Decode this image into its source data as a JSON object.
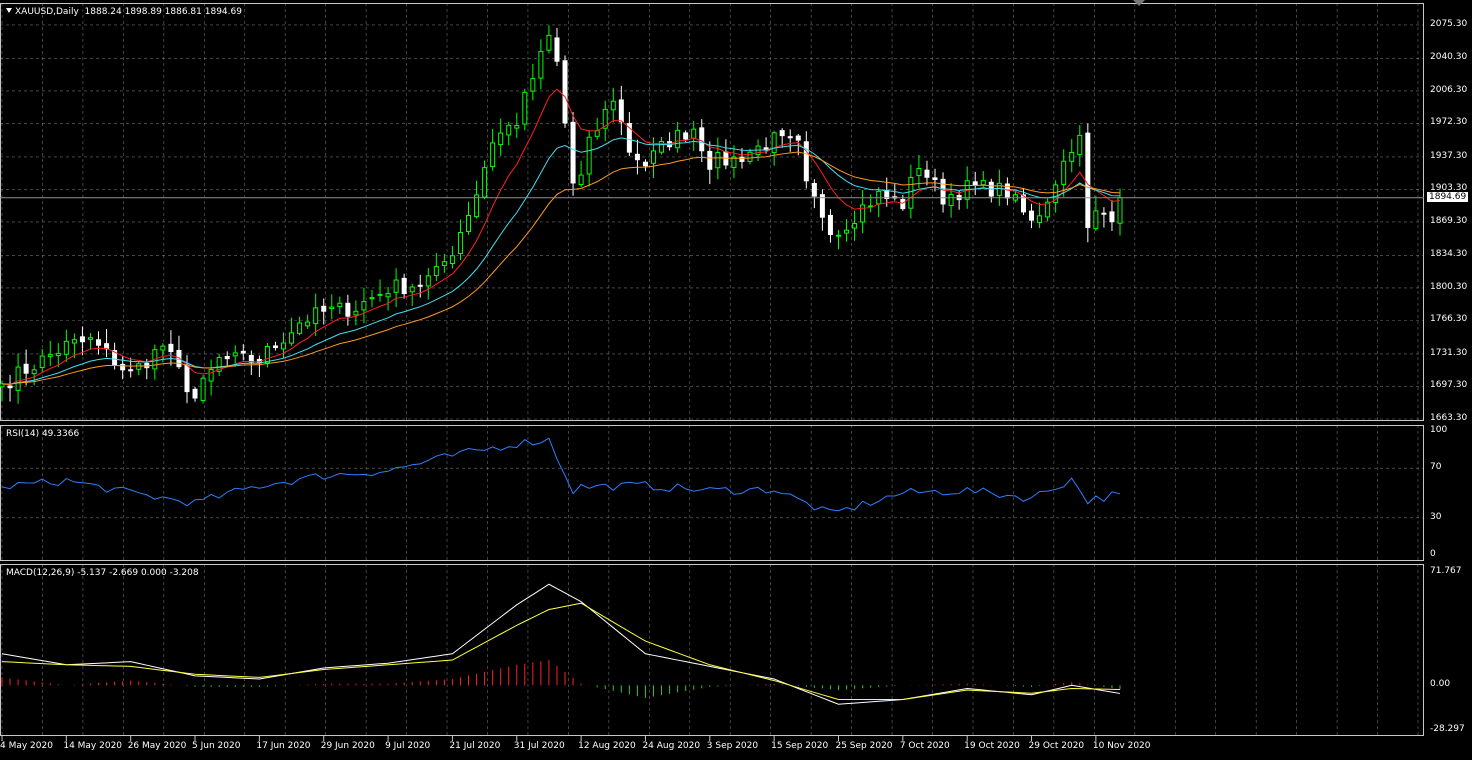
{
  "chart_header": {
    "symbol": "XAUUSD,Daily",
    "ohlc": "1888.24 1898.89 1886.81 1894.69"
  },
  "colors": {
    "background": "#000000",
    "grid": "#c8c8c8",
    "bull_candle": "#00ff00",
    "bear_candle": "#ffffff",
    "ma_fast": "#ff2020",
    "ma_mid": "#40e0f0",
    "ma_slow": "#ff9a20",
    "rsi_line": "#2f7fff",
    "macd_main": "#ffffff",
    "macd_signal": "#ffff40",
    "hist_up": "#ff2020",
    "hist_down": "#22cc22",
    "price_line": "#909090"
  },
  "price_axis": {
    "ticks": [
      "2075.30",
      "2040.30",
      "2006.30",
      "1972.30",
      "1937.30",
      "1903.30",
      "1869.30",
      "1834.30",
      "1800.30",
      "1766.30",
      "1731.30",
      "1697.30",
      "1663.30"
    ],
    "current_price": "1894.69"
  },
  "time_axis": {
    "labels": [
      "4 May 2020",
      "14 May 2020",
      "26 May 2020",
      "5 Jun 2020",
      "17 Jun 2020",
      "29 Jun 2020",
      "9 Jul 2020",
      "21 Jul 2020",
      "31 Jul 2020",
      "12 Aug 2020",
      "24 Aug 2020",
      "3 Sep 2020",
      "15 Sep 2020",
      "25 Sep 2020",
      "7 Oct 2020",
      "19 Oct 2020",
      "29 Oct 2020",
      "10 Nov 2020"
    ]
  },
  "rsi": {
    "label": "RSI(14) 49.3366",
    "levels": [
      "100",
      "70",
      "30",
      "0"
    ]
  },
  "macd": {
    "label": "MACD(12,26,9) -5.137 -2.669 0.000 -3.208",
    "levels": [
      "71.767",
      "0.00",
      "-28.297"
    ]
  },
  "chart_data": {
    "type": "candlestick",
    "title": "XAUUSD,Daily",
    "ylim": [
      1663.3,
      2092
    ],
    "close_anchors": [
      [
        "4 May 2020",
        1700
      ],
      [
        "14 May 2020",
        1740
      ],
      [
        "19 May 2020",
        1745
      ],
      [
        "26 May 2020",
        1710
      ],
      [
        "1 Jun 2020",
        1740
      ],
      [
        "5 Jun 2020",
        1685
      ],
      [
        "10 Jun 2020",
        1725
      ],
      [
        "17 Jun 2020",
        1725
      ],
      [
        "24 Jun 2020",
        1765
      ],
      [
        "29 Jun 2020",
        1775
      ],
      [
        "3 Jul 2020",
        1780
      ],
      [
        "9 Jul 2020",
        1800
      ],
      [
        "15 Jul 2020",
        1805
      ],
      [
        "17 Jul 2020",
        1815
      ],
      [
        "21 Jul 2020",
        1840
      ],
      [
        "24 Jul 2020",
        1900
      ],
      [
        "28 Jul 2020",
        1955
      ],
      [
        "31 Jul 2020",
        1975
      ],
      [
        "4 Aug 2020",
        2020
      ],
      [
        "6 Aug 2020",
        2062
      ],
      [
        "7 Aug 2020",
        2035
      ],
      [
        "11 Aug 2020",
        1910
      ],
      [
        "12 Aug 2020",
        1915
      ],
      [
        "13 Aug 2020",
        1950
      ],
      [
        "18 Aug 2020",
        2000
      ],
      [
        "20 Aug 2020",
        1945
      ],
      [
        "24 Aug 2020",
        1930
      ],
      [
        "27 Aug 2020",
        1955
      ],
      [
        "1 Sep 2020",
        1968
      ],
      [
        "3 Sep 2020",
        1932
      ],
      [
        "8 Sep 2020",
        1935
      ],
      [
        "15 Sep 2020",
        1955
      ],
      [
        "18 Sep 2020",
        1948
      ],
      [
        "21 Sep 2020",
        1905
      ],
      [
        "24 Sep 2020",
        1865
      ],
      [
        "25 Sep 2020",
        1860
      ],
      [
        "30 Sep 2020",
        1885
      ],
      [
        "2 Oct 2020",
        1897
      ],
      [
        "7 Oct 2020",
        1888
      ],
      [
        "9 Oct 2020",
        1930
      ],
      [
        "14 Oct 2020",
        1895
      ],
      [
        "19 Oct 2020",
        1905
      ],
      [
        "22 Oct 2020",
        1905
      ],
      [
        "26 Oct 2020",
        1900
      ],
      [
        "29 Oct 2020",
        1868
      ],
      [
        "30 Oct 2020",
        1880
      ],
      [
        "2 Nov 2020",
        1895
      ],
      [
        "5 Nov 2020",
        1950
      ],
      [
        "6 Nov 2020",
        1955
      ],
      [
        "9 Nov 2020",
        1860
      ],
      [
        "10 Nov 2020",
        1877
      ],
      [
        "12 Nov 2020",
        1878
      ],
      [
        "13 Nov 2020",
        1894.69
      ]
    ],
    "rsi_anchors": [
      [
        "4 May 2020",
        55
      ],
      [
        "14 May 2020",
        60
      ],
      [
        "26 May 2020",
        50
      ],
      [
        "5 Jun 2020",
        42
      ],
      [
        "17 Jun 2020",
        56
      ],
      [
        "29 Jun 2020",
        64
      ],
      [
        "9 Jul 2020",
        68
      ],
      [
        "21 Jul 2020",
        80
      ],
      [
        "31 Jul 2020",
        90
      ],
      [
        "6 Aug 2020",
        93
      ],
      [
        "11 Aug 2020",
        52
      ],
      [
        "12 Aug 2020",
        55
      ],
      [
        "24 Aug 2020",
        56
      ],
      [
        "3 Sep 2020",
        52
      ],
      [
        "15 Sep 2020",
        53
      ],
      [
        "24 Sep 2020",
        33
      ],
      [
        "7 Oct 2020",
        50
      ],
      [
        "19 Oct 2020",
        52
      ],
      [
        "29 Oct 2020",
        46
      ],
      [
        "5 Nov 2020",
        61
      ],
      [
        "9 Nov 2020",
        44
      ],
      [
        "13 Nov 2020",
        49.3366
      ]
    ],
    "macd_main_anchors": [
      [
        "4 May 2020",
        20
      ],
      [
        "14 May 2020",
        13
      ],
      [
        "26 May 2020",
        15
      ],
      [
        "5 Jun 2020",
        6
      ],
      [
        "17 Jun 2020",
        4
      ],
      [
        "29 Jun 2020",
        11
      ],
      [
        "9 Jul 2020",
        14
      ],
      [
        "21 Jul 2020",
        20
      ],
      [
        "31 Jul 2020",
        51
      ],
      [
        "6 Aug 2020",
        64
      ],
      [
        "12 Aug 2020",
        53
      ],
      [
        "24 Aug 2020",
        20
      ],
      [
        "3 Sep 2020",
        12
      ],
      [
        "15 Sep 2020",
        4
      ],
      [
        "25 Sep 2020",
        -12
      ],
      [
        "7 Oct 2020",
        -9
      ],
      [
        "19 Oct 2020",
        -2
      ],
      [
        "29 Oct 2020",
        -6
      ],
      [
        "5 Nov 2020",
        0
      ],
      [
        "13 Nov 2020",
        -5.137
      ]
    ],
    "macd_signal_anchors": [
      [
        "4 May 2020",
        15
      ],
      [
        "14 May 2020",
        13
      ],
      [
        "26 May 2020",
        12
      ],
      [
        "5 Jun 2020",
        7
      ],
      [
        "17 Jun 2020",
        5
      ],
      [
        "29 Jun 2020",
        10
      ],
      [
        "9 Jul 2020",
        13
      ],
      [
        "21 Jul 2020",
        16
      ],
      [
        "31 Jul 2020",
        38
      ],
      [
        "6 Aug 2020",
        48
      ],
      [
        "12 Aug 2020",
        52
      ],
      [
        "24 Aug 2020",
        28
      ],
      [
        "3 Sep 2020",
        13
      ],
      [
        "15 Sep 2020",
        3
      ],
      [
        "25 Sep 2020",
        -9
      ],
      [
        "7 Oct 2020",
        -9
      ],
      [
        "19 Oct 2020",
        -3
      ],
      [
        "29 Oct 2020",
        -5
      ],
      [
        "5 Nov 2020",
        -2
      ],
      [
        "13 Nov 2020",
        -2.669
      ]
    ]
  }
}
